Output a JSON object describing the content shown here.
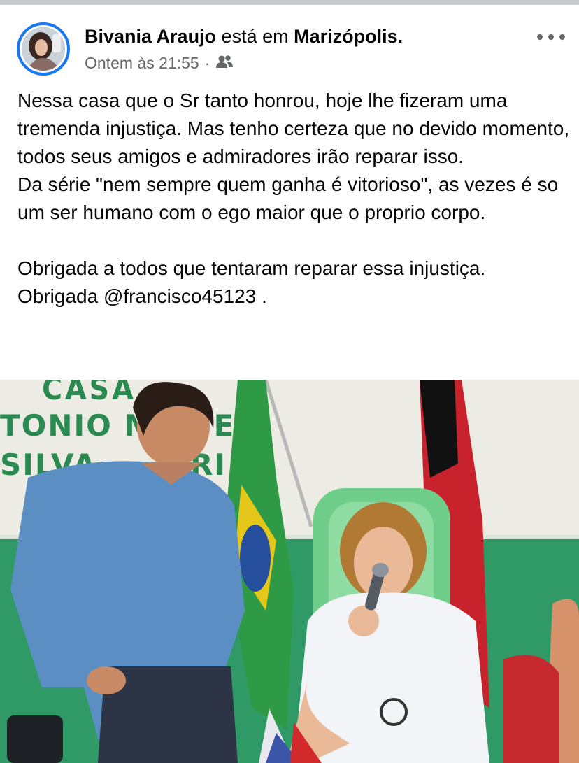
{
  "post": {
    "author": "Bivania Araujo",
    "connector": "está em",
    "location": "Marizópolis.",
    "timestamp": "Ontem às 21:55",
    "separator": "·",
    "audience_icon": "friends-icon",
    "more_icon": "more-options-icon",
    "avatar_icon": "profile-avatar",
    "paragraphs": [
      "Nessa casa que o Sr tanto honrou, hoje lhe fizeram uma tremenda injustiça. Mas tenho certeza que no devido momento, todos seus amigos e admiradores irão reparar isso.",
      "Da série \"nem sempre quem ganha é vitorioso\", as vezes é so um ser humano com o ego maior que o proprio corpo.",
      "Obrigada a todos que tentaram reparar essa injustiça.",
      "Obrigada @francisco45123 ."
    ]
  },
  "photo": {
    "wall_sign_lines": [
      "CASA",
      "TONIO MA   ES",
      "SILVA        RI"
    ]
  },
  "colors": {
    "accent": "#1877f2",
    "secondary_text": "#65676b",
    "wall_green": "#2f9a66",
    "shirt_blue": "#5b8fc4"
  }
}
